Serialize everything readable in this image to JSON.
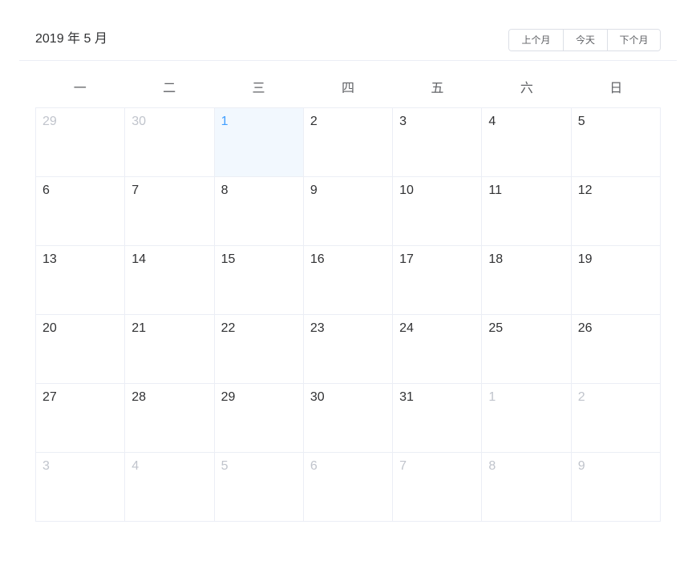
{
  "header": {
    "title": "2019 年 5 月",
    "prev_label": "上个月",
    "today_label": "今天",
    "next_label": "下个月"
  },
  "weekdays": [
    "一",
    "二",
    "三",
    "四",
    "五",
    "六",
    "日"
  ],
  "weeks": [
    [
      {
        "label": "29",
        "other": true
      },
      {
        "label": "30",
        "other": true
      },
      {
        "label": "1",
        "selected": true
      },
      {
        "label": "2"
      },
      {
        "label": "3"
      },
      {
        "label": "4"
      },
      {
        "label": "5"
      }
    ],
    [
      {
        "label": "6"
      },
      {
        "label": "7"
      },
      {
        "label": "8"
      },
      {
        "label": "9"
      },
      {
        "label": "10"
      },
      {
        "label": "11"
      },
      {
        "label": "12"
      }
    ],
    [
      {
        "label": "13"
      },
      {
        "label": "14"
      },
      {
        "label": "15"
      },
      {
        "label": "16"
      },
      {
        "label": "17"
      },
      {
        "label": "18"
      },
      {
        "label": "19"
      }
    ],
    [
      {
        "label": "20"
      },
      {
        "label": "21"
      },
      {
        "label": "22"
      },
      {
        "label": "23"
      },
      {
        "label": "24"
      },
      {
        "label": "25"
      },
      {
        "label": "26"
      }
    ],
    [
      {
        "label": "27"
      },
      {
        "label": "28"
      },
      {
        "label": "29"
      },
      {
        "label": "30"
      },
      {
        "label": "31"
      },
      {
        "label": "1",
        "other": true
      },
      {
        "label": "2",
        "other": true
      }
    ],
    [
      {
        "label": "3",
        "other": true
      },
      {
        "label": "4",
        "other": true
      },
      {
        "label": "5",
        "other": true
      },
      {
        "label": "6",
        "other": true
      },
      {
        "label": "7",
        "other": true
      },
      {
        "label": "8",
        "other": true
      },
      {
        "label": "9",
        "other": true
      }
    ]
  ],
  "colors": {
    "accent": "#409eff",
    "selected_bg": "#f2f8fe",
    "muted_text": "#c0c4cc",
    "border": "#ebeef5"
  }
}
